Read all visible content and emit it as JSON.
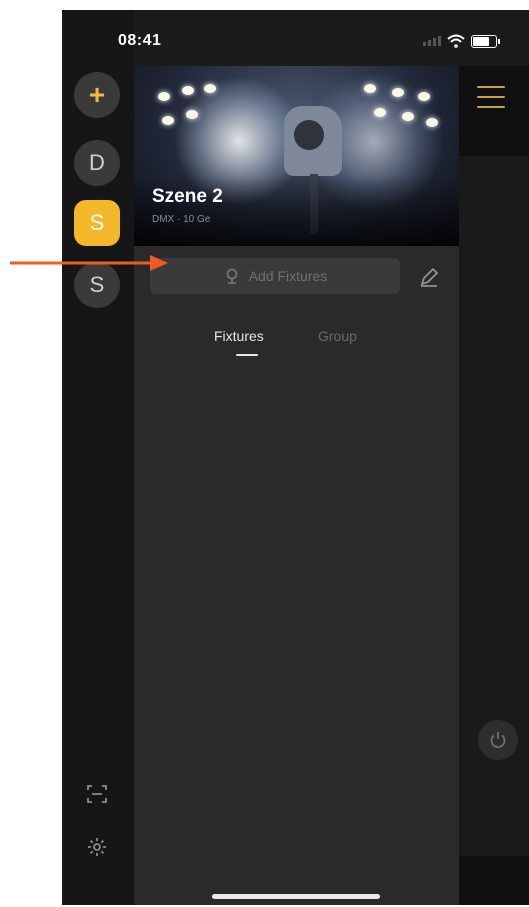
{
  "status_bar": {
    "time": "08:41"
  },
  "rail": {
    "add_label": "+",
    "items": [
      {
        "label": "D",
        "active": false
      },
      {
        "label": "S",
        "active": true
      },
      {
        "label": "S",
        "active": false
      }
    ],
    "bottom_icons": [
      "scan-icon",
      "settings-icon"
    ]
  },
  "scene": {
    "title": "Szene 2",
    "subtitle": "DMX · 10 Ge"
  },
  "add_fixture": {
    "label": "Add Fixtures",
    "icon": "lamp-icon"
  },
  "edit_icon": "pencil-icon",
  "tabs": [
    {
      "label": "Fixtures",
      "active": true
    },
    {
      "label": "Group",
      "active": false
    }
  ],
  "right_panel": {
    "menu_icon": "hamburger-icon",
    "power_icon": "power-icon"
  },
  "annotation": {
    "arrow_color": "#f15a22"
  },
  "colors": {
    "accent": "#f4b92b",
    "background": "#1b1b1b",
    "panel": "#2a2a2a"
  }
}
